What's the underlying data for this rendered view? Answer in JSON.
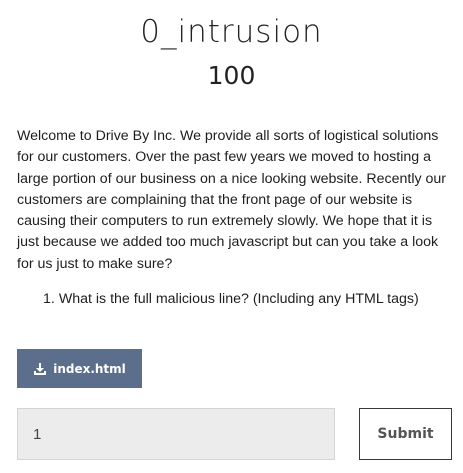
{
  "challenge": {
    "name": "0_intrusion",
    "value": "100",
    "description": "Welcome to Drive By Inc. We provide all sorts of logistical solutions for our customers. Over the past few years we moved to hosting a large portion of our business on a nice looking website. Recently our customers are complaining that the front page of our website is causing their computers to run extremely slowly. We hope that it is just because we added too much javascript but can you take a look for us just to make sure?",
    "questions": [
      {
        "number": "1.",
        "text": "What is the full malicious line? (Including any HTML tags)"
      }
    ]
  },
  "attachment": {
    "icon": "download-icon",
    "label": "index.html"
  },
  "flag_form": {
    "input_value": "1",
    "submit_label": "Submit"
  },
  "colors": {
    "download_button_bg": "#5b6f8c",
    "input_bg": "#ececec",
    "submit_border": "#3a3a3a"
  }
}
